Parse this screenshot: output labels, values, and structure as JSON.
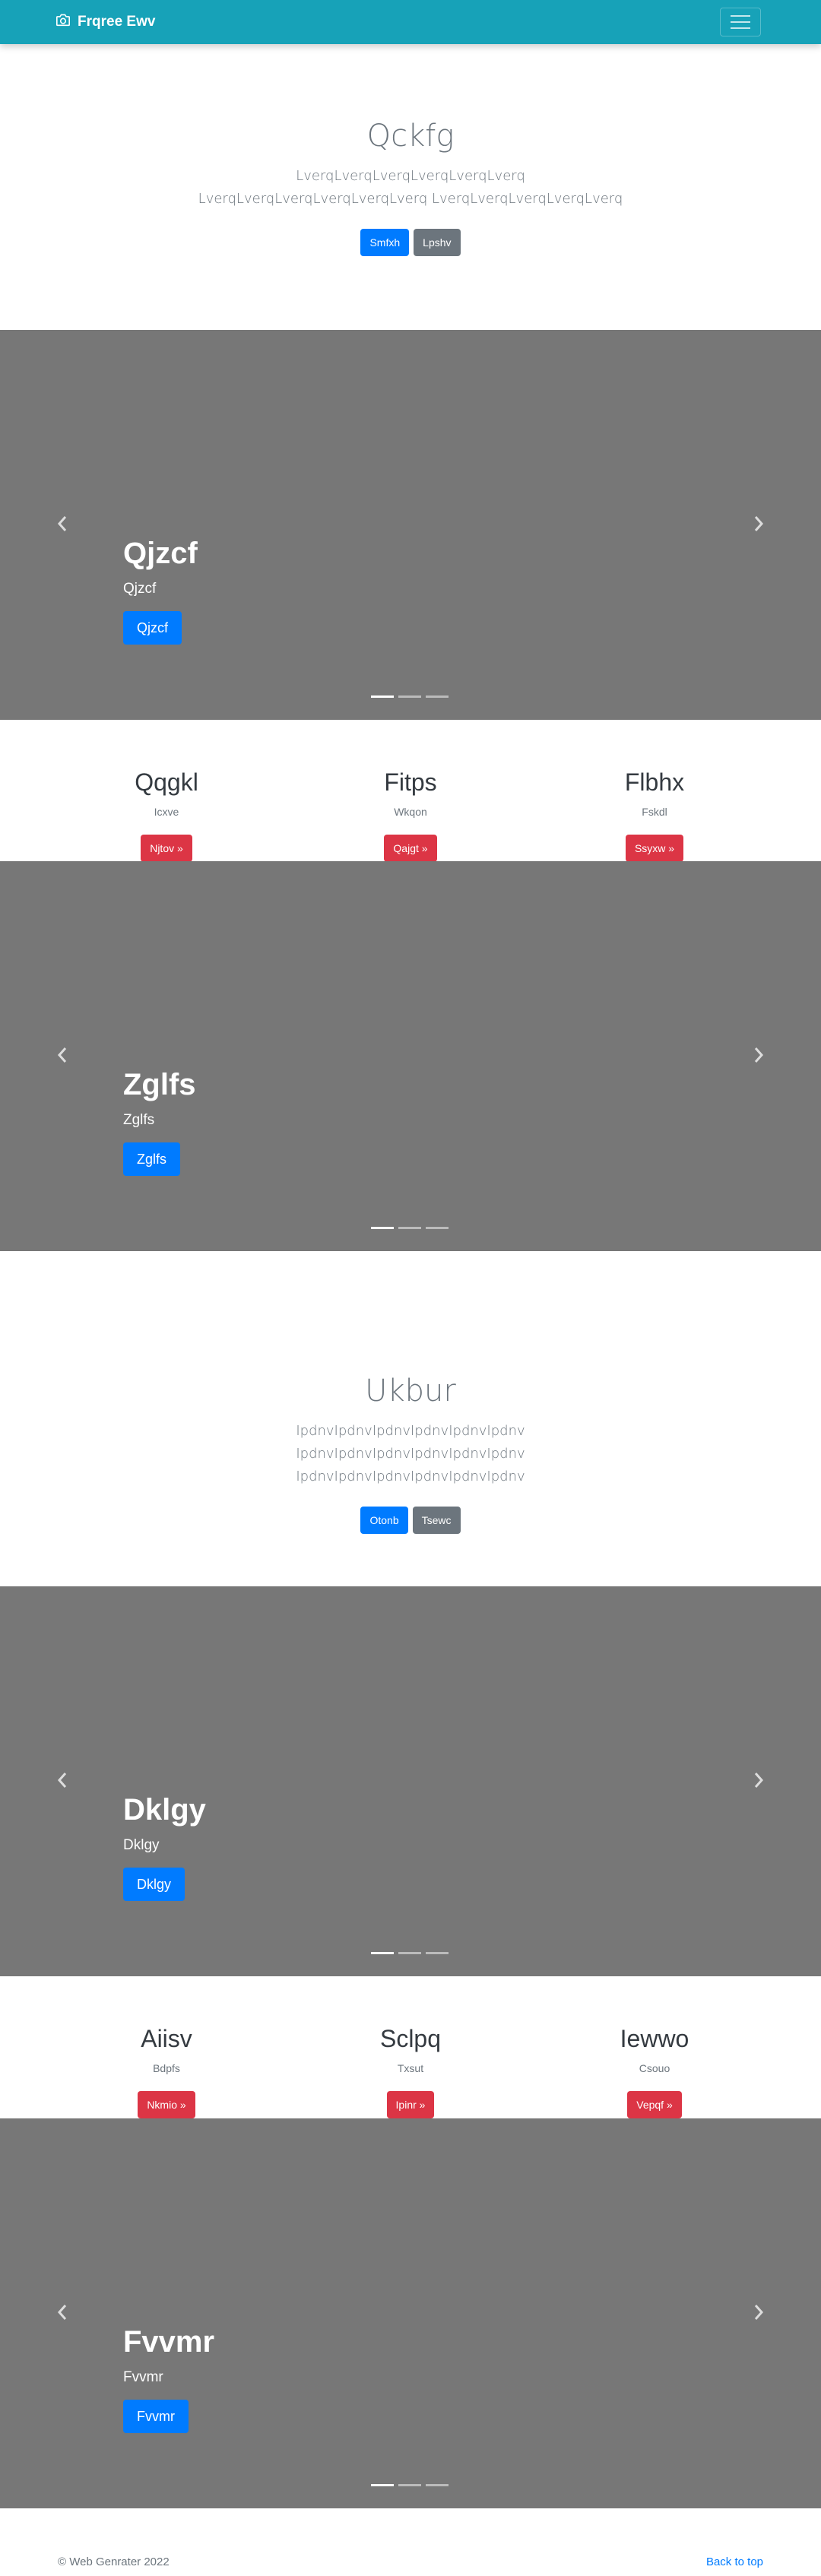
{
  "navbar": {
    "brand": "Frqree Ewv"
  },
  "jumbotron1": {
    "title": "Qckfg",
    "text": "LverqLverqLverqLverqLverqLverq LverqLverqLverqLverqLverqLverq LverqLverqLverqLverqLverq",
    "primary_label": "Smfxh",
    "secondary_label": "Lpshv"
  },
  "carousel1": {
    "title": "Qjzcf",
    "subtitle": "Qjzcf",
    "button": "Qjzcf"
  },
  "features1": [
    {
      "title": "Qqgkl",
      "text": "Icxve",
      "button": "Njtov »"
    },
    {
      "title": "Fitps",
      "text": "Wkqon",
      "button": "Qajgt »"
    },
    {
      "title": "Flbhx",
      "text": "Fskdl",
      "button": "Ssyxw »"
    }
  ],
  "carousel2": {
    "title": "Zglfs",
    "subtitle": "Zglfs",
    "button": "Zglfs"
  },
  "jumbotron2": {
    "title": "Ukbur",
    "text": "IpdnvIpdnvIpdnvIpdnvIpdnvIpdnv IpdnvIpdnvIpdnvIpdnvIpdnvIpdnv IpdnvIpdnvIpdnvIpdnvIpdnvIpdnv",
    "primary_label": "Otonb",
    "secondary_label": "Tsewc"
  },
  "carousel3": {
    "title": "Dklgy",
    "subtitle": "Dklgy",
    "button": "Dklgy"
  },
  "features2": [
    {
      "title": "Aiisv",
      "text": "Bdpfs",
      "button": "Nkmio »"
    },
    {
      "title": "Sclpq",
      "text": "Txsut",
      "button": "Ipinr »"
    },
    {
      "title": "Iewwo",
      "text": "Csouo",
      "button": "Vepqf »"
    }
  ],
  "carousel4": {
    "title": "Fvvmr",
    "subtitle": "Fvvmr",
    "button": "Fvvmr"
  },
  "footer": {
    "copyright": "© Web Genrater 2022",
    "back_to_top": "Back to top"
  },
  "colors": {
    "navbar": "#17a2b8",
    "primary": "#007bff",
    "secondary": "#6c757d",
    "danger": "#dc3545",
    "carousel_bg": "#777777"
  },
  "icons": {
    "brand": "camera-icon",
    "toggler": "hamburger-menu-icon",
    "carousel_prev": "chevron-left-icon",
    "carousel_next": "chevron-right-icon"
  }
}
